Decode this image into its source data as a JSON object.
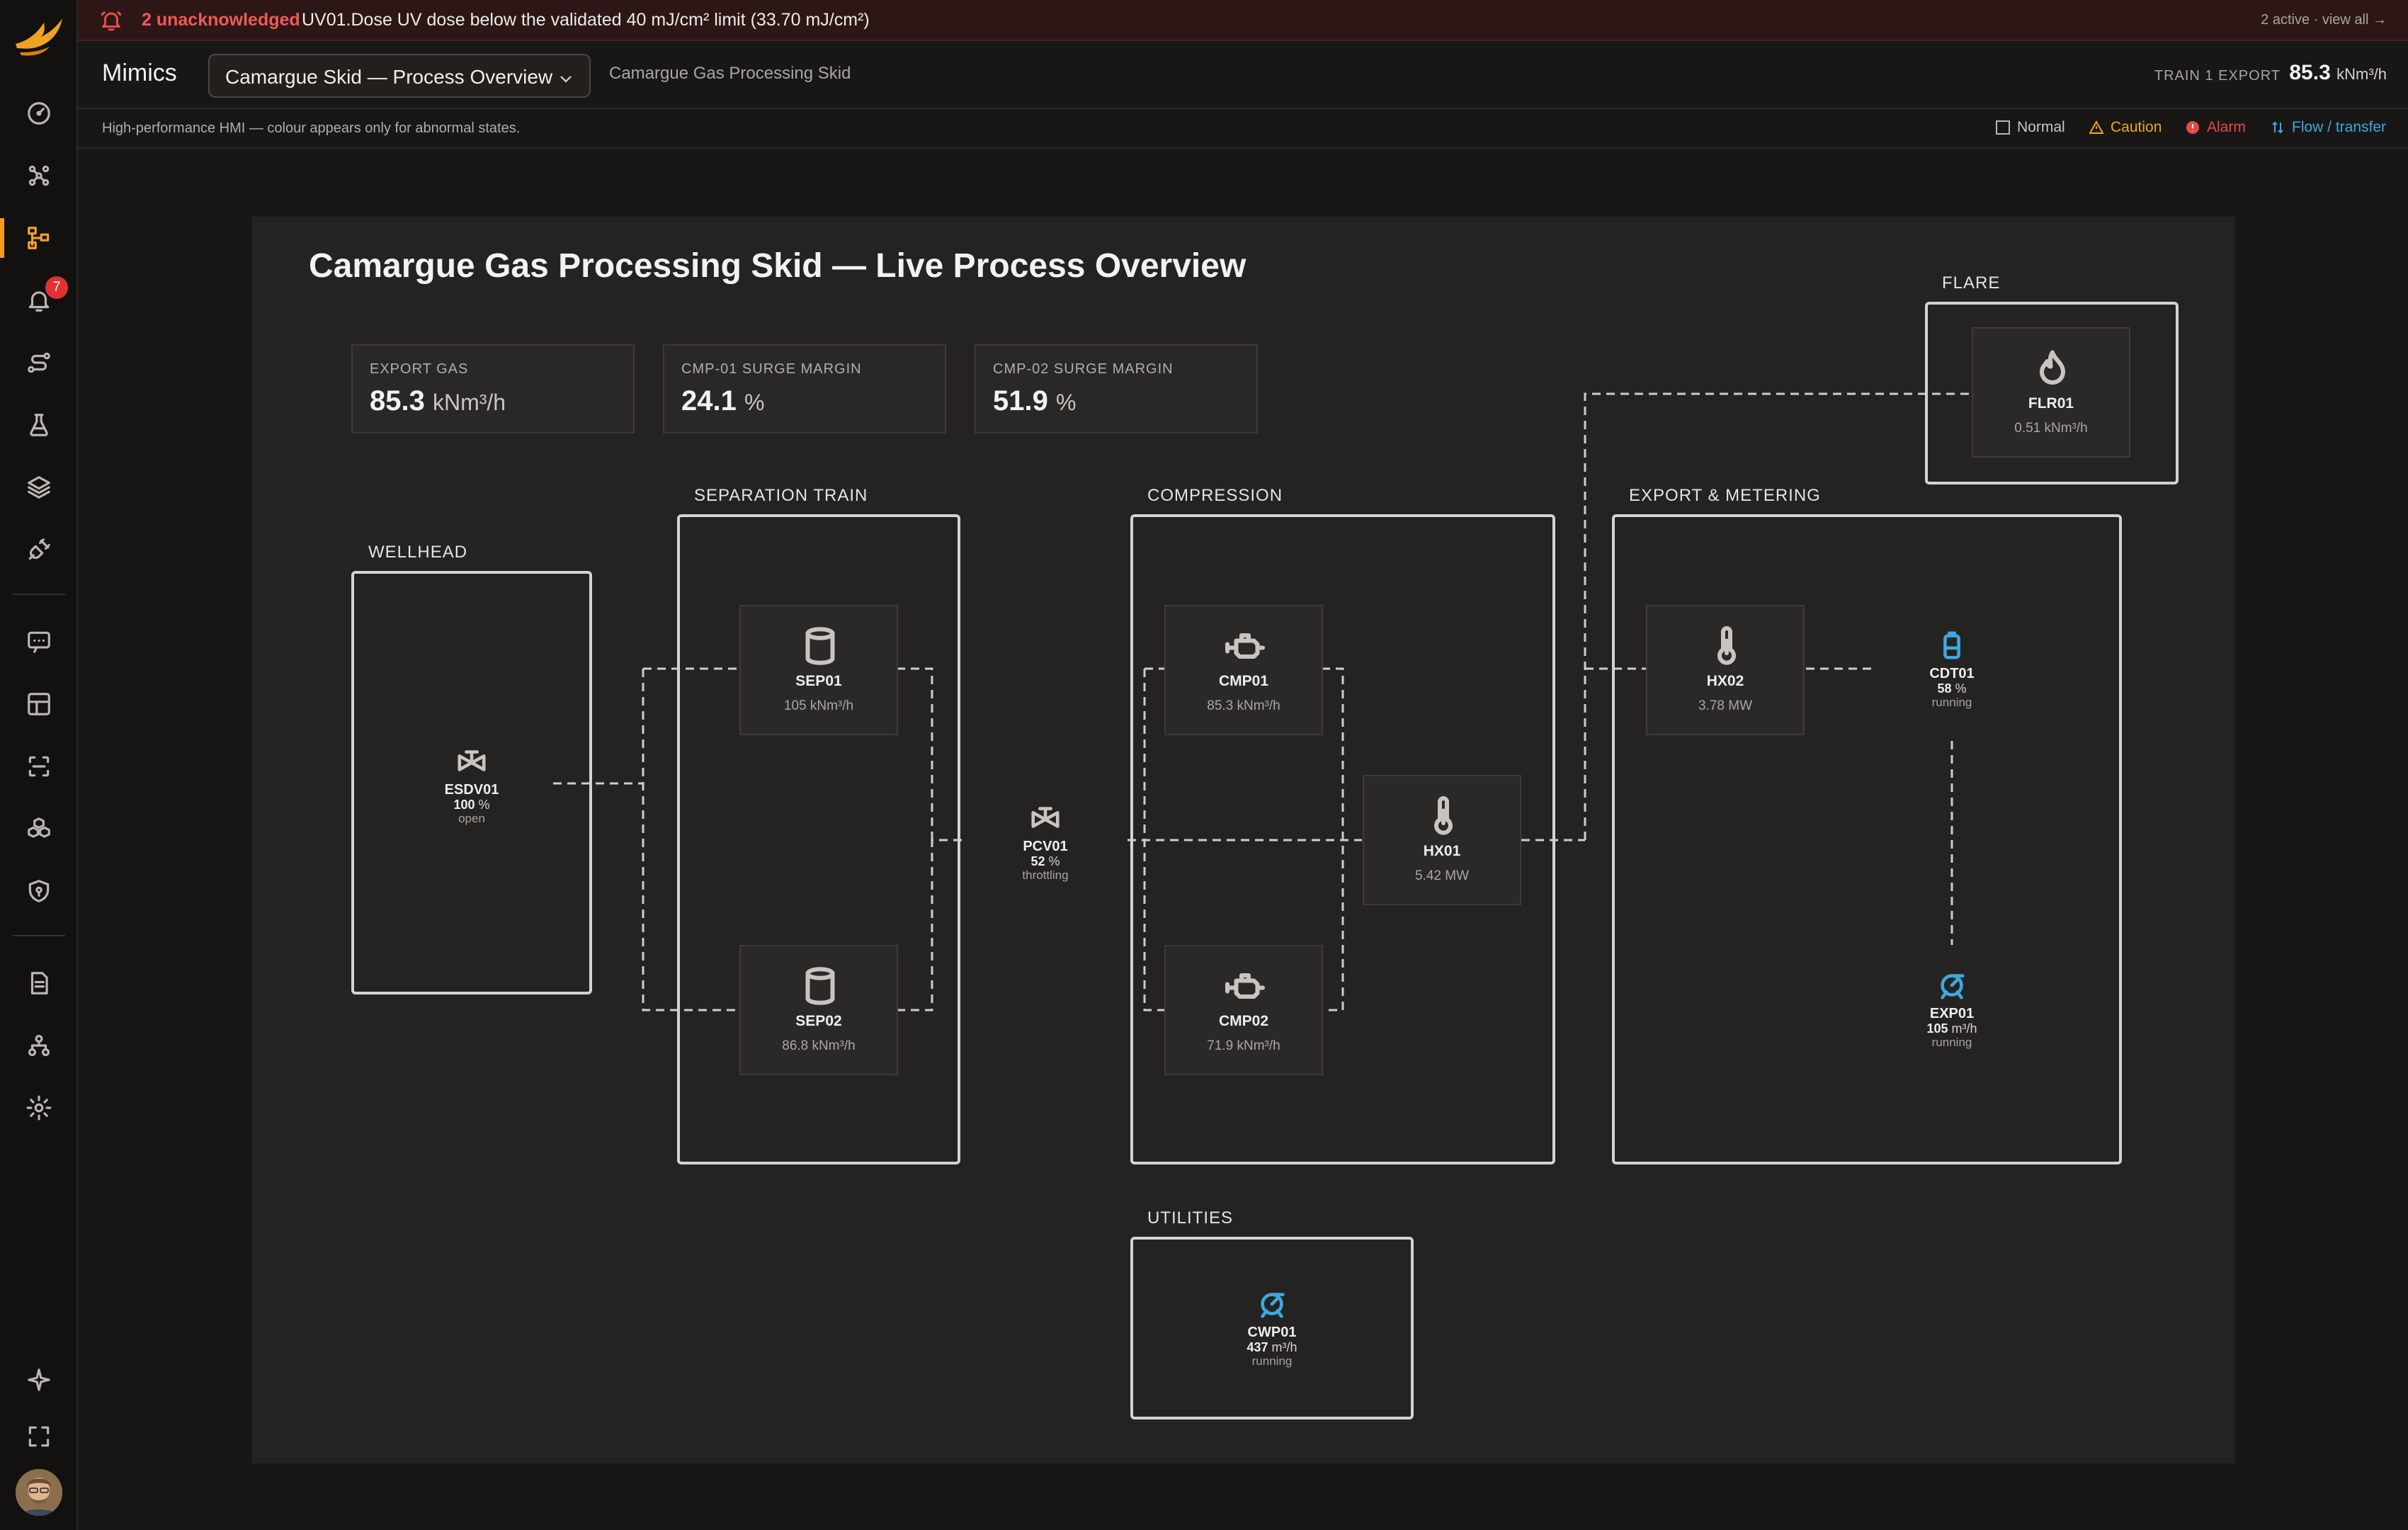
{
  "alert": {
    "count_label": "2 unacknowledged",
    "message": "UV01.Dose UV dose below the validated 40 mJ/cm² limit (33.70 mJ/cm²)",
    "view_all": "2 active · view all →"
  },
  "header": {
    "title": "Mimics",
    "mimic_select": "Camargue Skid — Process Overview",
    "subtitle": "Camargue Gas Processing Skid",
    "kpi_label": "TRAIN 1 EXPORT",
    "kpi_value": "85.3",
    "kpi_unit": "kNm³/h"
  },
  "rail": {
    "alarm_badge": "7",
    "icons": [
      "gauge-icon",
      "network-icon",
      "mimic-icon",
      "bell-icon",
      "route-icon",
      "flask-icon",
      "layers-icon",
      "plug-icon",
      "chat-icon",
      "grid-icon",
      "scan-icon",
      "cubes-icon",
      "shield-icon",
      "document-icon",
      "hierarchy-icon",
      "settings-icon",
      "sparkle-icon",
      "fullscreen-icon"
    ]
  },
  "legend": {
    "note": "High-performance HMI — colour appears only for abnormal states.",
    "normal": "Normal",
    "caution": "Caution",
    "alarm": "Alarm",
    "flow": "Flow / transfer",
    "colors": {
      "caution": "#f0a51d",
      "alarm": "#e64a47",
      "flow": "#3ea8de"
    }
  },
  "mimic": {
    "title": "Camargue Gas Processing Skid — Live Process Overview",
    "kpis": [
      {
        "label": "EXPORT GAS",
        "value": "85.3",
        "unit": "kNm³/h"
      },
      {
        "label": "CMP-01 SURGE MARGIN",
        "value": "24.1",
        "unit": "%"
      },
      {
        "label": "CMP-02 SURGE MARGIN",
        "value": "51.9",
        "unit": "%"
      }
    ],
    "zones": {
      "wellhead": "WELLHEAD",
      "separation": "SEPARATION TRAIN",
      "compression": "COMPRESSION",
      "export": "EXPORT & METERING",
      "flare": "FLARE",
      "utilities": "UTILITIES"
    },
    "equipment": {
      "esdv01": {
        "tag": "ESDV01",
        "value": "100",
        "unit": "%",
        "state": "open",
        "icon": "valve-icon"
      },
      "sep01": {
        "tag": "SEP01",
        "value": "105 kNm³/h",
        "icon": "vessel-icon"
      },
      "sep02": {
        "tag": "SEP02",
        "value": "86.8 kNm³/h",
        "icon": "vessel-icon"
      },
      "pcv01": {
        "tag": "PCV01",
        "value": "52",
        "unit": "%",
        "state": "throttling",
        "icon": "valve-icon"
      },
      "cmp01": {
        "tag": "CMP01",
        "value": "85.3 kNm³/h",
        "icon": "compressor-icon"
      },
      "cmp02": {
        "tag": "CMP02",
        "value": "71.9 kNm³/h",
        "icon": "compressor-icon"
      },
      "hx01": {
        "tag": "HX01",
        "value": "5.42 MW",
        "icon": "thermometer-icon"
      },
      "hx02": {
        "tag": "HX02",
        "value": "3.78 MW",
        "icon": "thermometer-icon"
      },
      "cdt01": {
        "tag": "CDT01",
        "value": "58",
        "unit": "%",
        "state": "running",
        "icon": "tank-icon"
      },
      "exp01": {
        "tag": "EXP01",
        "value": "105",
        "unit": "m³/h",
        "state": "running",
        "icon": "pump-icon"
      },
      "flr01": {
        "tag": "FLR01",
        "value": "0.51 kNm³/h",
        "icon": "flame-icon"
      },
      "cwp01": {
        "tag": "CWP01",
        "value": "437",
        "unit": "m³/h",
        "state": "running",
        "icon": "pump-icon"
      }
    }
  }
}
